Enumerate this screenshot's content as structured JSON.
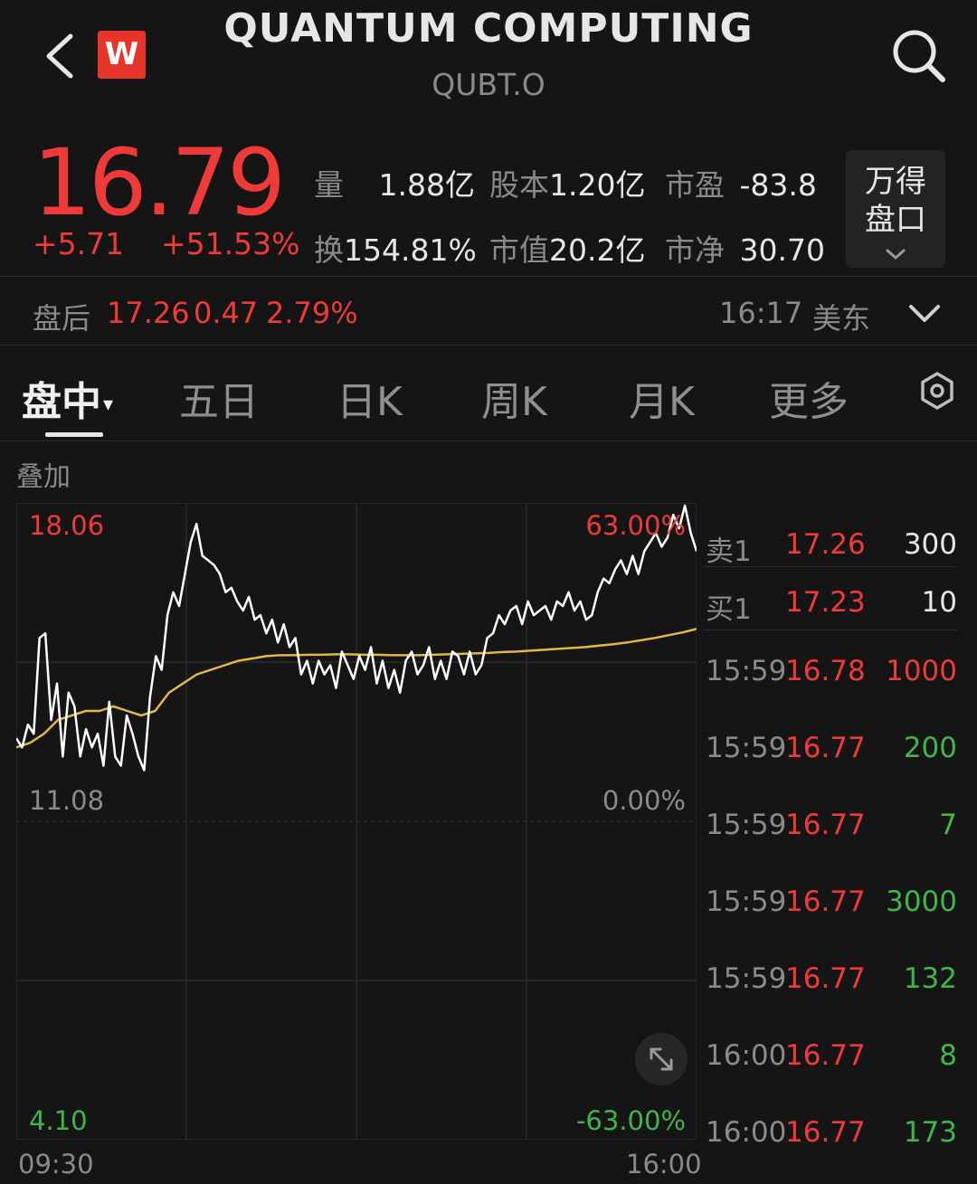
{
  "header": {
    "title": "QUANTUM COMPUTING",
    "code": "QUBT.O",
    "logo_letter": "W",
    "icons": [
      "back-icon",
      "search-icon"
    ]
  },
  "quote": {
    "price": "16.79",
    "change": "+5.71",
    "change_pct": "+51.53%",
    "stats": {
      "volume_label": "量",
      "volume": "1.88亿",
      "shares_label": "股本",
      "shares": "1.20亿",
      "pe_label": "市盈",
      "pe": "-83.8",
      "turnover_label": "换",
      "turnover": "154.81%",
      "mktcap_label": "市值",
      "mktcap": "20.2亿",
      "pb_label": "市净",
      "pb": "30.70"
    },
    "panel_button": [
      "万得",
      "盘口"
    ]
  },
  "after_hours": {
    "label": "盘后",
    "price": "17.26",
    "change": "0.47",
    "pct": "2.79%",
    "time": "16:17",
    "timezone": "美东"
  },
  "tabs": [
    "盘中",
    "五日",
    "日K",
    "周K",
    "月K",
    "更多"
  ],
  "overlay_label": "叠加",
  "chart_data": {
    "type": "line",
    "y_max_label": "18.06",
    "y_mid_label": "11.08",
    "y_min_label": "4.10",
    "pct_max_label": "63.00%",
    "pct_mid_label": "0.00%",
    "pct_min_label": "-63.00%",
    "x_start": "09:30",
    "x_end": "16:00",
    "ylim": [
      4.1,
      18.06
    ],
    "series": [
      {
        "color": "#ffffff",
        "values": [
          12.9,
          12.7,
          13.2,
          13.0,
          15.1,
          15.2,
          13.3,
          14.1,
          12.5,
          13.9,
          13.6,
          12.5,
          13.1,
          12.7,
          13.0,
          12.3,
          13.7,
          12.5,
          12.3,
          13.4,
          13.0,
          12.5,
          12.2,
          13.8,
          14.7,
          14.4,
          15.6,
          16.1,
          15.8,
          16.5,
          17.2,
          17.6,
          16.9,
          16.8,
          16.7,
          16.5,
          16.1,
          16.2,
          15.9,
          15.7,
          16.0,
          15.5,
          15.6,
          15.2,
          15.5,
          15.0,
          15.4,
          14.9,
          15.1,
          14.3,
          14.6,
          14.1,
          14.6,
          14.3,
          14.5,
          14.0,
          14.8,
          14.5,
          14.2,
          14.7,
          14.4,
          14.9,
          14.1,
          14.6,
          14.0,
          14.4,
          13.9,
          14.6,
          14.8,
          14.3,
          14.5,
          14.9,
          14.2,
          14.6,
          14.2,
          14.8,
          14.7,
          14.3,
          14.8,
          14.3,
          14.5,
          15.1,
          15.2,
          15.6,
          15.4,
          15.7,
          15.8,
          15.4,
          15.9,
          15.6,
          15.7,
          15.8,
          15.5,
          15.9,
          15.8,
          16.1,
          15.7,
          15.9,
          15.5,
          15.6,
          16.1,
          16.4,
          16.3,
          16.6,
          16.8,
          16.5,
          16.9,
          16.5,
          17.0,
          17.2,
          17.4,
          17.1,
          17.3,
          17.8,
          17.5,
          18.0,
          17.4,
          17.0
        ]
      },
      {
        "color": "#e0b94a",
        "values": [
          12.7,
          12.8,
          13.0,
          13.3,
          13.4,
          13.5,
          13.5,
          13.6,
          13.5,
          13.4,
          13.5,
          13.9,
          14.1,
          14.3,
          14.4,
          14.5,
          14.6,
          14.65,
          14.7,
          14.72,
          14.72,
          14.73,
          14.73,
          14.74,
          14.74,
          14.73,
          14.73,
          14.72,
          14.72,
          14.72,
          14.73,
          14.74,
          14.75,
          14.76,
          14.77,
          14.79,
          14.8,
          14.82,
          14.84,
          14.86,
          14.88,
          14.9,
          14.93,
          14.96,
          15.0,
          15.05,
          15.1,
          15.16,
          15.22,
          15.3
        ]
      }
    ]
  },
  "order_book": {
    "asks": [
      {
        "label": "卖1",
        "price": "17.26",
        "volume": "300"
      }
    ],
    "bids": [
      {
        "label": "买1",
        "price": "17.23",
        "volume": "10"
      }
    ],
    "trades": [
      {
        "time": "15:59",
        "price": "16.78",
        "volume": "1000",
        "color": "#f03a3a"
      },
      {
        "time": "15:59",
        "price": "16.77",
        "volume": "200",
        "color": "#3fb54a"
      },
      {
        "time": "15:59",
        "price": "16.77",
        "volume": "7",
        "color": "#3fb54a"
      },
      {
        "time": "15:59",
        "price": "16.77",
        "volume": "3000",
        "color": "#3fb54a"
      },
      {
        "time": "15:59",
        "price": "16.77",
        "volume": "132",
        "color": "#3fb54a"
      },
      {
        "time": "16:00",
        "price": "16.77",
        "volume": "8",
        "color": "#3fb54a"
      },
      {
        "time": "16:00",
        "price": "16.77",
        "volume": "173",
        "color": "#3fb54a"
      }
    ]
  },
  "colors": {
    "up": "#f03a3a",
    "down": "#3fb54a",
    "avg_line": "#e0b94a",
    "background": "#151515"
  }
}
